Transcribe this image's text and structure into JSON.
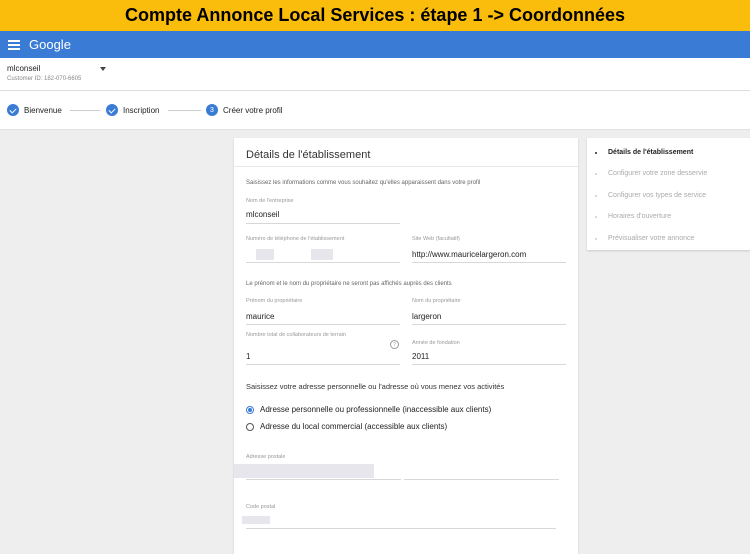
{
  "banner": {
    "title": "Compte Annonce Local Services : étape 1 -> Coordonnées"
  },
  "appbar": {
    "logo": "Google"
  },
  "account": {
    "name": "mlconseil",
    "customer_id": "Customer ID: 182-070-6605"
  },
  "steps": [
    {
      "label": "Bienvenue",
      "status": "done"
    },
    {
      "label": "Inscription",
      "status": "done"
    },
    {
      "label": "Créer votre profil",
      "status": "current",
      "number": "3"
    }
  ],
  "form": {
    "title": "Détails de l'établissement",
    "intro": "Saisissez les informations comme vous souhaitez qu'elles apparaissent dans votre profil",
    "company": {
      "label": "Nom de l'entreprise",
      "value": "mlconseil"
    },
    "phone": {
      "label": "Numéro de téléphone de l'établissement"
    },
    "website": {
      "label": "Site Web (facultatif)",
      "value": "http://www.mauricelargeron.com"
    },
    "owner_note": "Le prénom et le nom du propriétaire ne seront pas affichés auprès des clients",
    "first_name": {
      "label": "Prénom du propriétaire",
      "value": "maurice"
    },
    "last_name": {
      "label": "Nom du propriétaire",
      "value": "largeron"
    },
    "staff": {
      "label": "Nombre total de collaborateurs de terrain",
      "value": "1",
      "help": "?"
    },
    "founded": {
      "label": "Année de fondation",
      "value": "2011"
    },
    "address_question": "Saisissez votre adresse personnelle ou l'adresse où vous menez vos activités",
    "address_options": [
      {
        "label": "Adresse personnelle ou professionnelle (inaccessible aux clients)",
        "selected": true
      },
      {
        "label": "Adresse du local commercial (accessible aux clients)",
        "selected": false
      }
    ],
    "postal_address": {
      "label": "Adresse postale"
    },
    "postal_code": {
      "label": "Code postal"
    }
  },
  "sidebar": {
    "items": [
      {
        "label": "Détails de l'établissement",
        "active": true
      },
      {
        "label": "Configurer votre zone desservie",
        "active": false
      },
      {
        "label": "Configurer vos types de service",
        "active": false
      },
      {
        "label": "Horaires d'ouverture",
        "active": false
      },
      {
        "label": "Prévisualiser votre annonce",
        "active": false
      }
    ]
  },
  "colors": {
    "banner": "#fbbd0c",
    "appbar": "#3a7cd5",
    "accent": "#3a7cd5"
  }
}
